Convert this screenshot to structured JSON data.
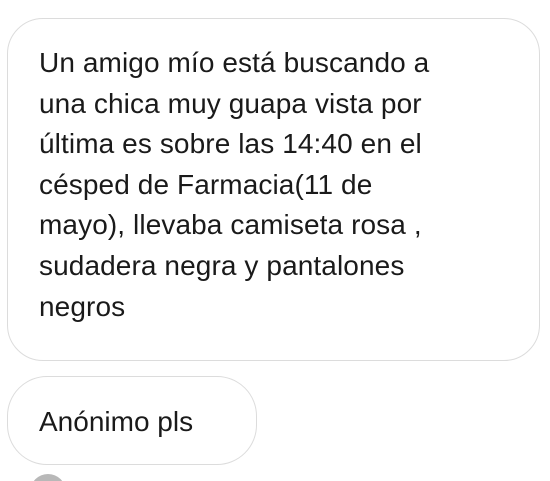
{
  "conversation": {
    "messages": [
      {
        "text": "Un amigo mío está buscando a\nuna chica muy guapa vista por\núltima es sobre las 14:40 en el\ncésped de Farmacia(11 de\nmayo), llevaba camiseta rosa ,\nsudadera negra y pantalones\nnegros"
      },
      {
        "text": "Anónimo pls"
      }
    ]
  },
  "colors": {
    "bubble_border": "#dcdcdc",
    "text": "#1a1a1a",
    "background": "#ffffff"
  },
  "icons": {
    "reaction": "heart-icon"
  }
}
